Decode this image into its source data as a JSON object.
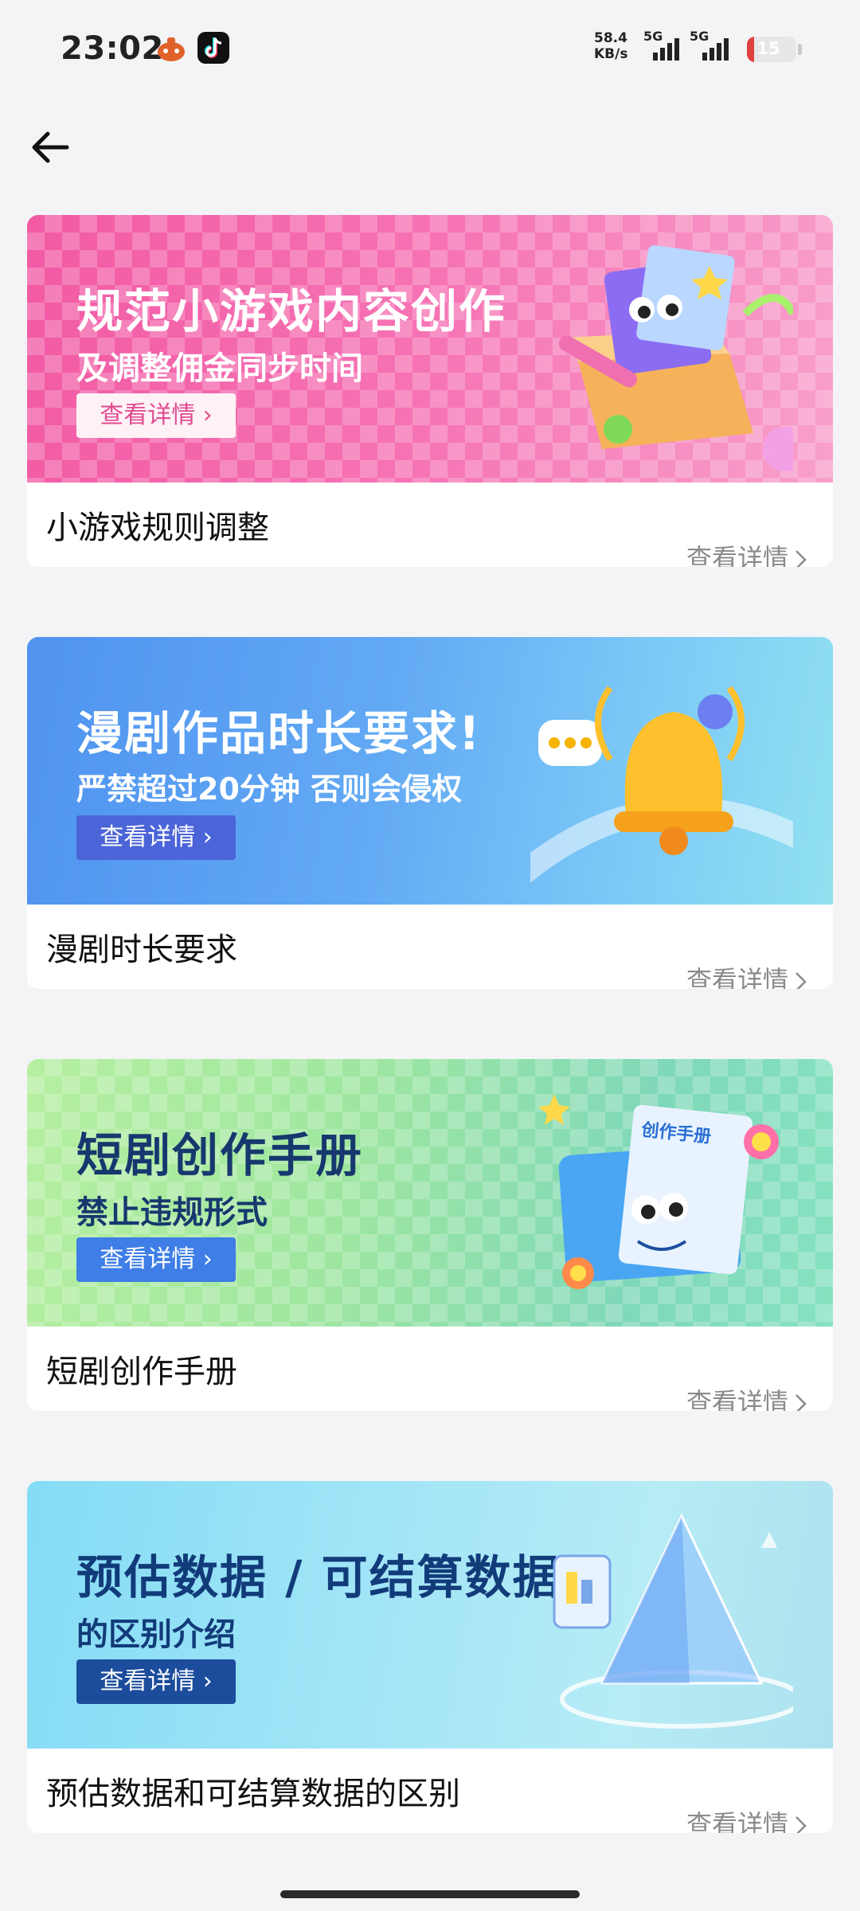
{
  "status_bar": {
    "time": "23:02",
    "net_speed_value": "58.4",
    "net_speed_unit": "KB/s",
    "net_type_1": "5G",
    "net_type_2": "5G",
    "battery": "15",
    "battery_level": 0.15,
    "icons": [
      "app-notification-icon",
      "tiktok-icon",
      "signal-icon",
      "signal-icon",
      "battery-icon"
    ]
  },
  "nav": {
    "back_icon": "back-arrow-icon"
  },
  "cards": [
    {
      "banner_title": "规范小游戏内容创作",
      "banner_subtitle": "及调整佣金同步时间",
      "banner_button": "查看详情 ›",
      "title": "小游戏规则调整",
      "more": "查看详情",
      "accent": "#f25aa4"
    },
    {
      "banner_title": "漫剧作品时长要求!",
      "banner_subtitle": "严禁超过20分钟 否则会侵权",
      "banner_button": "查看详情 ›",
      "title": "漫剧时长要求",
      "more": "查看详情",
      "accent": "#4f93f0"
    },
    {
      "banner_title": "短剧创作手册",
      "banner_subtitle": "禁止违规形式",
      "banner_button": "查看详情 ›",
      "title": "短剧创作手册",
      "more": "查看详情",
      "accent": "#9ee6a0"
    },
    {
      "banner_title": "预估数据 / 可结算数据",
      "banner_subtitle": "的区别介绍",
      "banner_button": "查看详情 ›",
      "title": "预估数据和可结算数据的区别",
      "more": "查看详情",
      "accent": "#84dcf5"
    }
  ],
  "illustration_labels": {
    "card3_book": "创作手册"
  }
}
